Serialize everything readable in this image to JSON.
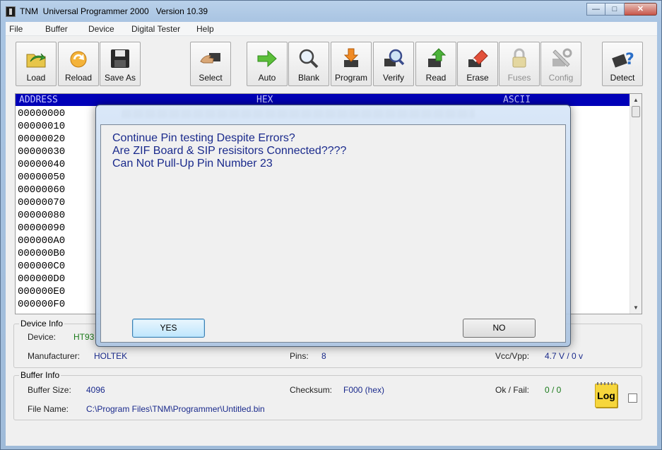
{
  "window": {
    "title": "TNM  Universal Programmer 2000   Version 10.39",
    "min_glyph": "—",
    "max_glyph": "□",
    "close_glyph": "✕"
  },
  "menu": [
    "File",
    "Buffer",
    "Device",
    "Digital Tester",
    "Help"
  ],
  "toolbar": {
    "load": "Load",
    "reload": "Reload",
    "save_as": "Save As",
    "select": "Select",
    "auto": "Auto",
    "blank": "Blank",
    "program": "Program",
    "verify": "Verify",
    "read": "Read",
    "erase": "Erase",
    "fuses": "Fuses",
    "config": "Config",
    "detect": "Detect"
  },
  "hex": {
    "col_address": "ADDRESS",
    "col_hex": "HEX",
    "col_ascii": "ASCII",
    "addresses": [
      "00000000",
      "00000010",
      "00000020",
      "00000030",
      "00000040",
      "00000050",
      "00000060",
      "00000070",
      "00000080",
      "00000090",
      "000000A0",
      "000000B0",
      "000000C0",
      "000000D0",
      "000000E0",
      "000000F0"
    ]
  },
  "device_info": {
    "group_title": "Device Info",
    "device_label": "Device:",
    "device_value": "HT93",
    "manufacturer_label": "Manufacturer:",
    "manufacturer_value": "HOLTEK",
    "pins_label": "Pins:",
    "pins_value": "8",
    "vcc_label": "Vcc/Vpp:",
    "vcc_value": "4.7 V / 0 v"
  },
  "buffer_info": {
    "group_title": "Buffer Info",
    "size_label": "Buffer Size:",
    "size_value": "4096",
    "checksum_label": "Checksum:",
    "checksum_value": "F000 (hex)",
    "okfail_label": "Ok / Fail:",
    "okfail_value": "0 / 0",
    "filename_label": "File Name:",
    "filename_value": "C:\\Program Files\\TNM\\Programmer\\Untitled.bin",
    "log_label": "Log"
  },
  "dialog": {
    "line1": "Continue Pin testing Despite Errors?",
    "line2": "Are ZIF Board & SIP resisitors Connected????",
    "line3": "Can Not Pull-Up Pin Number 23",
    "yes": "YES",
    "no": "NO"
  },
  "colors": {
    "hex_header_bg": "#0000b8",
    "value_blue": "#1a2a8c",
    "value_green": "#1a7a1a"
  }
}
